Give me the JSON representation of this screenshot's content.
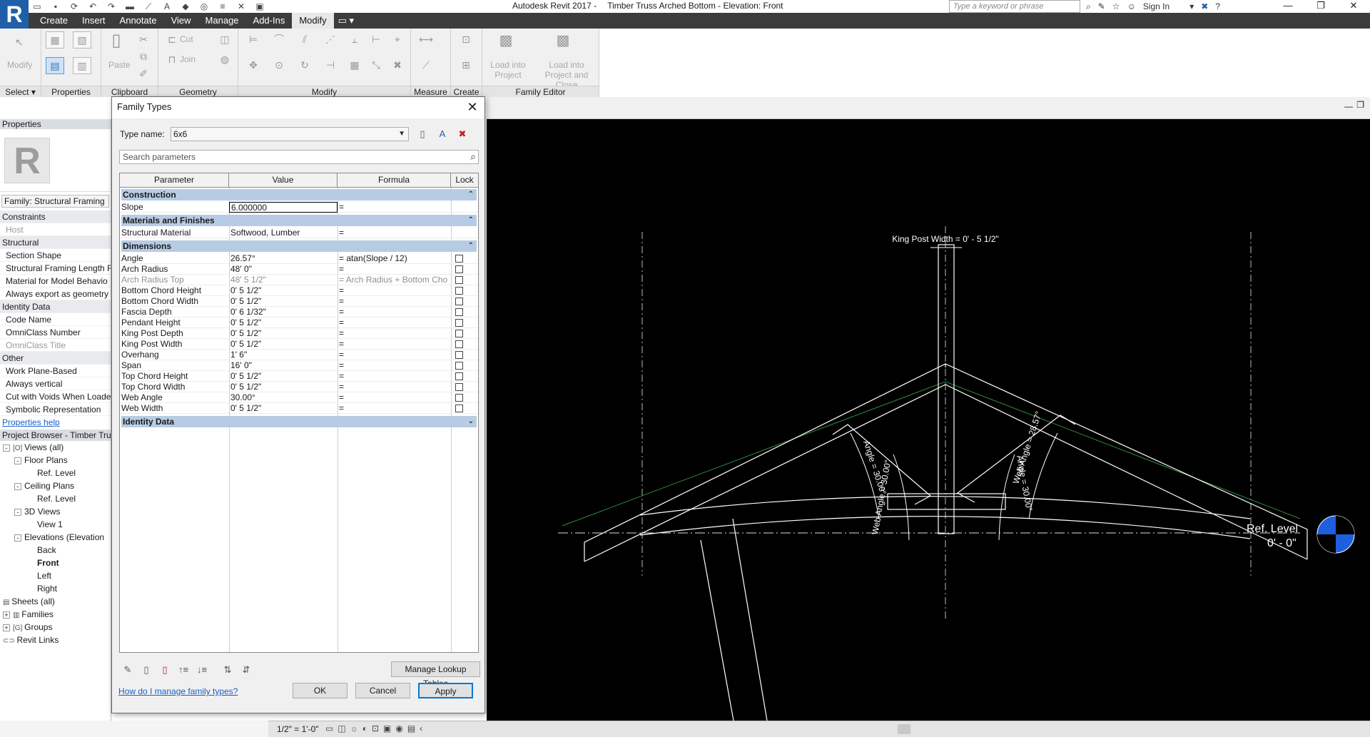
{
  "app": {
    "name": "Autodesk Revit 2017 -",
    "document": "Timber Truss Arched Bottom - Elevation: Front",
    "search_placeholder": "Type a keyword or phrase",
    "sign_in": "Sign In",
    "logo_letter": "R"
  },
  "tabs": [
    "Create",
    "Insert",
    "Annotate",
    "View",
    "Manage",
    "Add-Ins",
    "Modify"
  ],
  "active_tab": "Modify",
  "ribbon": {
    "panels": [
      "Select ▾",
      "Properties",
      "Clipboard",
      "Geometry",
      "Modify",
      "Measure",
      "Create",
      "Family Editor"
    ],
    "modify_label": "Modify",
    "paste_label": "Paste",
    "cut_label": "Cut",
    "join_label": "Join",
    "load_project": "Load into Project",
    "load_project_close": "Load into Project and Close"
  },
  "properties": {
    "header": "Properties",
    "logo_letter": "R",
    "family": "Family: Structural Framing",
    "rows": [
      {
        "text": "Constraints",
        "kind": "group"
      },
      {
        "text": "Host",
        "kind": "dim"
      },
      {
        "text": "Structural",
        "kind": "group"
      },
      {
        "text": "Section Shape",
        "kind": "item"
      },
      {
        "text": "Structural Framing Length R",
        "kind": "item"
      },
      {
        "text": "Material for Model Behavio",
        "kind": "item"
      },
      {
        "text": "Always export as geometry",
        "kind": "item"
      },
      {
        "text": "Identity Data",
        "kind": "group"
      },
      {
        "text": "Code Name",
        "kind": "item"
      },
      {
        "text": "OmniClass Number",
        "kind": "item"
      },
      {
        "text": "OmniClass Title",
        "kind": "dim"
      },
      {
        "text": "Other",
        "kind": "group"
      },
      {
        "text": "Work Plane-Based",
        "kind": "item"
      },
      {
        "text": "Always vertical",
        "kind": "item"
      },
      {
        "text": "Cut with Voids When Loade",
        "kind": "item"
      },
      {
        "text": "Symbolic Representation",
        "kind": "item"
      }
    ],
    "help": "Properties help"
  },
  "browser": {
    "header": "Project Browser - Timber Truss",
    "items": [
      {
        "label": "Views (all)",
        "indent": 0,
        "exp": "-",
        "icon": "[O]"
      },
      {
        "label": "Floor Plans",
        "indent": 1,
        "exp": "-"
      },
      {
        "label": "Ref. Level",
        "indent": 3,
        "exp": ""
      },
      {
        "label": "Ceiling Plans",
        "indent": 1,
        "exp": "-"
      },
      {
        "label": "Ref. Level",
        "indent": 3,
        "exp": ""
      },
      {
        "label": "3D Views",
        "indent": 1,
        "exp": "-"
      },
      {
        "label": "View 1",
        "indent": 3,
        "exp": ""
      },
      {
        "label": "Elevations (Elevation",
        "indent": 1,
        "exp": "-"
      },
      {
        "label": "Back",
        "indent": 3,
        "exp": ""
      },
      {
        "label": "Front",
        "indent": 3,
        "exp": "",
        "bold": true
      },
      {
        "label": "Left",
        "indent": 3,
        "exp": ""
      },
      {
        "label": "Right",
        "indent": 3,
        "exp": ""
      },
      {
        "label": "Sheets (all)",
        "indent": 0,
        "exp": "",
        "icon": "▤"
      },
      {
        "label": "Families",
        "indent": 0,
        "exp": "+",
        "icon": "▥"
      },
      {
        "label": "Groups",
        "indent": 0,
        "exp": "+",
        "icon": "[G]"
      },
      {
        "label": "Revit Links",
        "indent": 0,
        "exp": "",
        "icon": "⊂⊃"
      }
    ]
  },
  "dialog": {
    "title": "Family Types",
    "type_name_label": "Type name:",
    "type_name": "6x6",
    "search_placeholder": "Search parameters",
    "columns": [
      "Parameter",
      "Value",
      "Formula",
      "Lock"
    ],
    "sections": [
      {
        "name": "Construction",
        "chev": "⌃",
        "rows": [
          {
            "param": "Slope",
            "value": "6.000000",
            "formula": "=",
            "lock": false,
            "editing": true
          }
        ]
      },
      {
        "name": "Materials and Finishes",
        "chev": "⌃",
        "rows": [
          {
            "param": "Structural Material",
            "value": "Softwood, Lumber",
            "formula": "=",
            "lock": false
          }
        ]
      },
      {
        "name": "Dimensions",
        "chev": "⌃",
        "rows": [
          {
            "param": "Angle",
            "value": "26.57°",
            "formula": "= atan(Slope / 12)",
            "lock": true
          },
          {
            "param": "Arch Radius",
            "value": "48'  0\"",
            "formula": "=",
            "lock": true
          },
          {
            "param": "Arch Radius Top",
            "value": "48'  5 1/2\"",
            "formula": "= Arch Radius + Bottom Cho",
            "lock": true,
            "dim": true
          },
          {
            "param": "Bottom Chord Height",
            "value": "0'  5 1/2\"",
            "formula": "=",
            "lock": true
          },
          {
            "param": "Bottom Chord Width",
            "value": "0'  5 1/2\"",
            "formula": "=",
            "lock": true
          },
          {
            "param": "Fascia Depth",
            "value": "0'  6 1/32\"",
            "formula": "=",
            "lock": true
          },
          {
            "param": "Pendant Height",
            "value": "0'  5 1/2\"",
            "formula": "=",
            "lock": true
          },
          {
            "param": "King Post Depth",
            "value": "0'  5 1/2\"",
            "formula": "=",
            "lock": true
          },
          {
            "param": "King Post Width",
            "value": "0'  5 1/2\"",
            "formula": "=",
            "lock": true
          },
          {
            "param": "Overhang",
            "value": "1'  6\"",
            "formula": "=",
            "lock": true
          },
          {
            "param": "Span",
            "value": "16'  0\"",
            "formula": "=",
            "lock": true
          },
          {
            "param": "Top Chord Height",
            "value": "0'  5 1/2\"",
            "formula": "=",
            "lock": true
          },
          {
            "param": "Top Chord Width",
            "value": "0'  5 1/2\"",
            "formula": "=",
            "lock": true
          },
          {
            "param": "Web Angle",
            "value": "30.00°",
            "formula": "=",
            "lock": true
          },
          {
            "param": "Web Width",
            "value": "0'  5 1/2\"",
            "formula": "=",
            "lock": true
          }
        ]
      },
      {
        "name": "Identity Data",
        "chev": "⌄",
        "rows": []
      }
    ],
    "manage_lookup": "Manage Lookup Tables",
    "help_link": "How do I manage family types?",
    "ok": "OK",
    "cancel": "Cancel",
    "apply": "Apply"
  },
  "drawing": {
    "king_post_label": "King Post Width = 0' - 5 1/2\"",
    "ref_level": "Ref. Level",
    "ref_elev": "0' - 0\"",
    "angle_left_1": "Angle = 30.00°",
    "angle_left_2": "Web Angle = 30.00°",
    "angle_right_1": "Web Angle = 28.57°",
    "angle_right_2": "Angle = 30.00°"
  },
  "viewbar": {
    "scale": "1/2\" = 1'-0\""
  },
  "colors": {
    "ribbon_tab_bg": "#3c3c3c",
    "section_bg": "#b7cce4",
    "canvas_bg": "#000000",
    "level_marker": "#1e5fe0"
  }
}
